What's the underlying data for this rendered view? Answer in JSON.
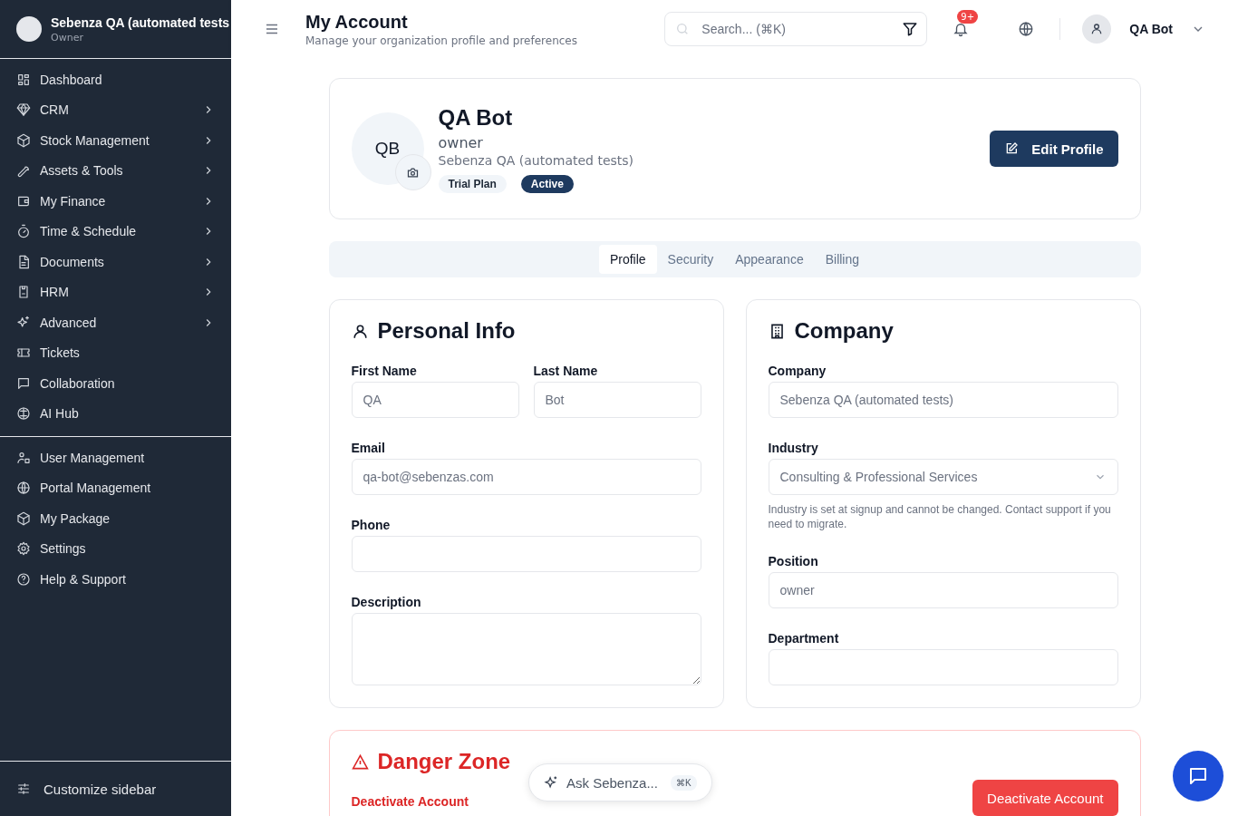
{
  "sidebar": {
    "org_name": "Sebenza QA (automated tests",
    "org_role": "Owner",
    "items": [
      {
        "label": "Dashboard",
        "has_submenu": false
      },
      {
        "label": "CRM",
        "has_submenu": true
      },
      {
        "label": "Stock Management",
        "has_submenu": true
      },
      {
        "label": "Assets & Tools",
        "has_submenu": true
      },
      {
        "label": "My Finance",
        "has_submenu": true
      },
      {
        "label": "Time & Schedule",
        "has_submenu": true
      },
      {
        "label": "Documents",
        "has_submenu": true
      },
      {
        "label": "HRM",
        "has_submenu": true
      },
      {
        "label": "Advanced",
        "has_submenu": true
      },
      {
        "label": "Tickets",
        "has_submenu": false
      },
      {
        "label": "Collaboration",
        "has_submenu": false
      },
      {
        "label": "AI Hub",
        "has_submenu": false
      }
    ],
    "admin_items": [
      {
        "label": "User Management"
      },
      {
        "label": "Portal Management"
      },
      {
        "label": "My Package"
      },
      {
        "label": "Settings"
      },
      {
        "label": "Help & Support"
      }
    ],
    "footer": "Customize sidebar"
  },
  "header": {
    "title": "My Account",
    "subtitle": "Manage your organization profile and preferences",
    "search": {
      "placeholder": "Search... (⌘K)"
    },
    "notification_badge": "9+",
    "user": "QA Bot"
  },
  "profile": {
    "initials": "QB",
    "name": "QA Bot",
    "role": "owner",
    "organization": "Sebenza QA (automated tests)",
    "badges": [
      {
        "label": "Trial Plan",
        "kind": "plan"
      },
      {
        "label": "Active",
        "kind": "status"
      }
    ],
    "edit_button": "Edit Profile"
  },
  "tabs": [
    {
      "label": "Profile",
      "selected": true
    },
    {
      "label": "Security",
      "selected": false
    },
    {
      "label": "Appearance",
      "selected": false
    },
    {
      "label": "Billing",
      "selected": false
    }
  ],
  "personal_info": {
    "title": "Personal Info",
    "fields": [
      {
        "label": "First Name",
        "value": "QA",
        "kind": "input",
        "half": true
      },
      {
        "label": "Last Name",
        "value": "Bot",
        "kind": "input",
        "half": true
      },
      {
        "label": "Email",
        "value": "qa-bot@sebenzas.com",
        "kind": "input",
        "half": false
      },
      {
        "label": "Phone",
        "kind": "input",
        "half": false
      },
      {
        "label": "Description",
        "kind": "textarea",
        "half": false
      }
    ]
  },
  "company": {
    "title": "Company",
    "fields": [
      {
        "label": "Company",
        "value": "Sebenza QA (automated tests)",
        "kind": "input"
      },
      {
        "label": "Industry",
        "value": "Consulting & Professional Services",
        "kind": "select",
        "help": "Industry is set at signup and cannot be changed. Contact support if you need to migrate."
      },
      {
        "label": "Position",
        "value": "owner",
        "kind": "input"
      },
      {
        "label": "Department",
        "kind": "input"
      }
    ]
  },
  "danger_zone": {
    "title": "Danger Zone",
    "item_title": "Deactivate Account",
    "button": "Deactivate Account"
  },
  "assistant": {
    "label": "Ask Sebenza...",
    "shortcut": "⌘K"
  }
}
